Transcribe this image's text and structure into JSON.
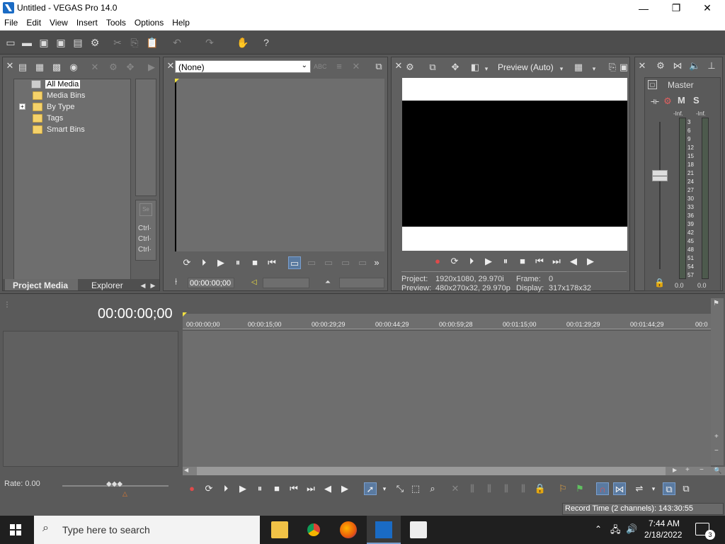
{
  "window": {
    "title": "Untitled - VEGAS Pro 14.0",
    "min_glyph": "—",
    "max_glyph": "❐",
    "close_glyph": "✕"
  },
  "menu": [
    "File",
    "Edit",
    "View",
    "Insert",
    "Tools",
    "Options",
    "Help"
  ],
  "project_media": {
    "tree": [
      "All Media",
      "Media Bins",
      "By Type",
      "Tags",
      "Smart Bins"
    ],
    "expander": "+",
    "tabs": [
      "Project Media",
      "Explorer"
    ],
    "side_labels": [
      "Ctrl·",
      "Ctrl·",
      "Ctrl·"
    ]
  },
  "trimmer": {
    "dropdown_value": "(None)",
    "timecode": "00:00:00;00"
  },
  "preview": {
    "mode": "Preview (Auto)",
    "project_label": "Project:",
    "project_value": "1920x1080, 29.970i",
    "frame_label": "Frame:",
    "frame_value": "0",
    "preview_label": "Preview:",
    "preview_value": "480x270x32, 29.970p",
    "display_label": "Display:",
    "display_value": "317x178x32"
  },
  "master": {
    "label": "Master",
    "m_label": "M",
    "s_label": "S",
    "inf_left": "-Inf.",
    "inf_right": "-Inf.",
    "scale": [
      "3",
      "6",
      "9",
      "12",
      "15",
      "18",
      "21",
      "24",
      "27",
      "30",
      "33",
      "36",
      "39",
      "42",
      "45",
      "48",
      "51",
      "54",
      "57"
    ],
    "value_left": "0.0",
    "value_right": "0.0"
  },
  "timeline": {
    "timecode": "00:00:00;00",
    "ruler": [
      "00:00:00;00",
      "00:00:15;00",
      "00:00:29;29",
      "00:00:44;29",
      "00:00:59;28",
      "00:01:15;00",
      "00:01:29;29",
      "00:01:44;29",
      "00:0"
    ],
    "rate": "Rate: 0.00",
    "record_time": "Record Time (2 channels): 143:30:55"
  },
  "taskbar": {
    "search_placeholder": "Type here to search",
    "time": "7:44 AM",
    "date": "2/18/2022",
    "notif_count": "3"
  },
  "colors": {
    "accent": "#1a6bc4",
    "folder": "#f5d26a",
    "record": "#e04a4a"
  }
}
